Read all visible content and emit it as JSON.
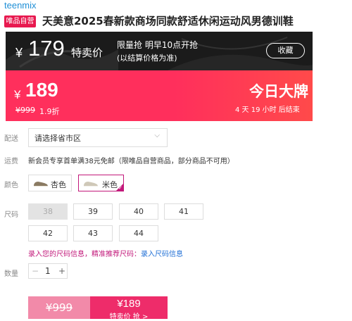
{
  "header": {
    "brand": "teenmix",
    "badge": "唯品自营",
    "title": "天美意2025春新款商场同款舒适休闲运动风男德训鞋"
  },
  "promo": {
    "upcoming_price": "179",
    "currency": "¥",
    "upcoming_label": "特卖价",
    "limited_text": "限量抢 明早10点开抢",
    "settle_note": "(以结算价格为准)",
    "favorite_label": "收藏",
    "current_price": "189",
    "original_price": "¥999",
    "discount": "1.9折",
    "event_name": "今日大牌",
    "countdown": "4 天 19 小时 后结束"
  },
  "labels": {
    "delivery": "配送",
    "shipping": "运费",
    "color": "颜色",
    "size": "尺码",
    "quantity": "数量"
  },
  "delivery": {
    "placeholder": "请选择省市区",
    "chevron": "chevron-down-icon"
  },
  "shipping_text": "新会员专享首单满38元免邮（限唯品自营商品，部分商品不可用）",
  "colors": [
    {
      "label": "杏色",
      "selected": false,
      "shoe_color": "#8a7a62"
    },
    {
      "label": "米色",
      "selected": true,
      "shoe_color": "#cfc8b8"
    }
  ],
  "sizes": [
    {
      "label": "38",
      "disabled": true
    },
    {
      "label": "39",
      "disabled": false
    },
    {
      "label": "40",
      "disabled": false
    },
    {
      "label": "41",
      "disabled": false
    },
    {
      "label": "42",
      "disabled": false
    },
    {
      "label": "43",
      "disabled": false
    },
    {
      "label": "44",
      "disabled": false
    }
  ],
  "size_hint": {
    "text": "录入您的尺码信息，精准推荐尺码：",
    "link": "录入尺码信息"
  },
  "quantity": {
    "minus": "−",
    "value": "1",
    "plus": "+"
  },
  "buy": {
    "original_price": "¥999",
    "price": "¥189",
    "action": "特卖价 抢 >"
  },
  "colors_theme": {
    "accent": "#e8194f",
    "magenta": "#c2187a",
    "link": "#1f6fd6",
    "dark": "#1b1b1b"
  }
}
